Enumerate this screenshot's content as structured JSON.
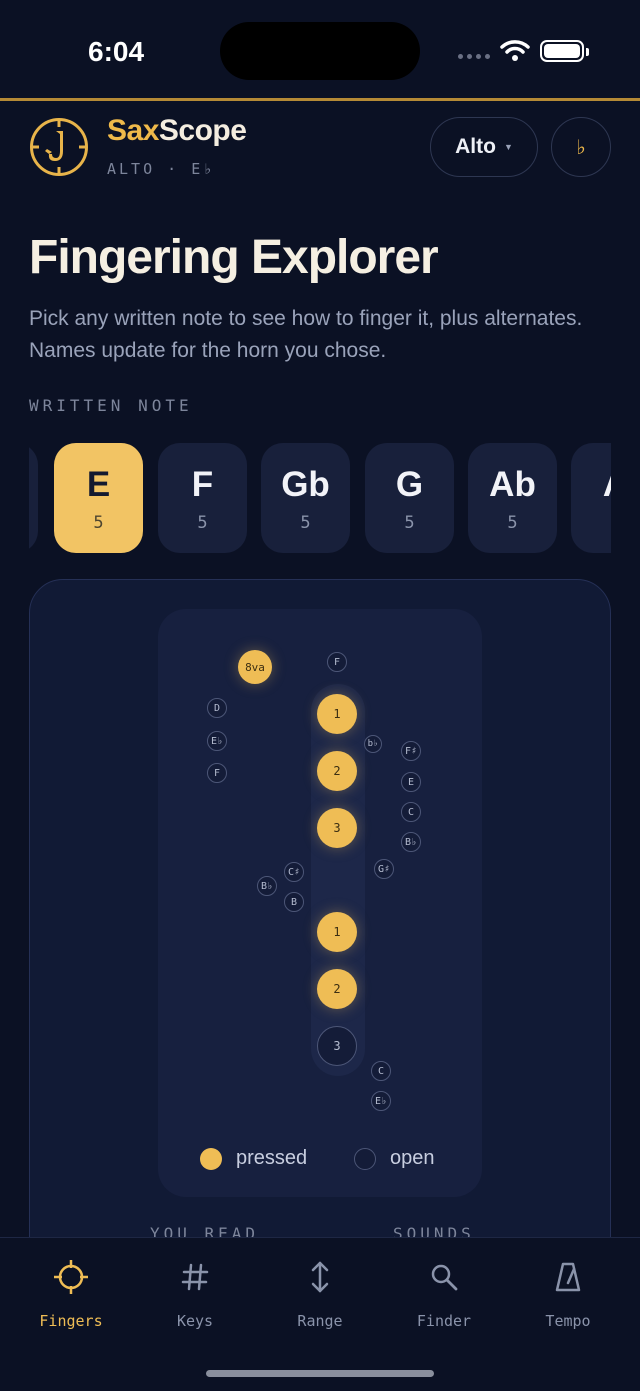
{
  "status": {
    "time": "6:04"
  },
  "header": {
    "brand_sax": "Sax",
    "brand_scope": "Scope",
    "subtitle": "ALTO · E♭",
    "horn_button": "Alto",
    "accidental_button": "♭"
  },
  "page": {
    "title": "Fingering Explorer",
    "description": "Pick any written note to see how to finger it, plus alternates. Names update for the horn you chose.",
    "section_label": "WRITTEN NOTE"
  },
  "notes": [
    {
      "name": "E",
      "octave": "5",
      "selected": true
    },
    {
      "name": "F",
      "octave": "5",
      "selected": false
    },
    {
      "name": "Gb",
      "octave": "5",
      "selected": false
    },
    {
      "name": "G",
      "octave": "5",
      "selected": false
    },
    {
      "name": "Ab",
      "octave": "5",
      "selected": false
    },
    {
      "name": "A",
      "octave": "",
      "selected": false
    }
  ],
  "diagram": {
    "octave_key": "8va",
    "keys": {
      "top_f": "F",
      "palm_d": "D",
      "palm_eb": "E♭",
      "palm_f": "F",
      "upper_1": "1",
      "upper_2": "2",
      "upper_3": "3",
      "bis": "b♭",
      "side_fs": "F♯",
      "side_e": "E",
      "side_c": "C",
      "side_bb": "B♭",
      "g_sharp": "G♯",
      "pinky_cs": "C♯",
      "pinky_bb": "B♭",
      "pinky_b": "B",
      "lower_1": "1",
      "lower_2": "2",
      "lower_3": "3",
      "low_c": "C",
      "low_eb": "E♭"
    },
    "legend_pressed": "pressed",
    "legend_open": "open"
  },
  "readout": {
    "you_read": "YOU READ",
    "sounds": "SOUNDS"
  },
  "tabs": [
    {
      "label": "Fingers",
      "icon": "crosshair-icon",
      "active": true
    },
    {
      "label": "Keys",
      "icon": "hash-icon",
      "active": false
    },
    {
      "label": "Range",
      "icon": "vertical-arrows-icon",
      "active": false
    },
    {
      "label": "Finder",
      "icon": "search-icon",
      "active": false
    },
    {
      "label": "Tempo",
      "icon": "metronome-icon",
      "active": false
    }
  ],
  "colors": {
    "accent": "#efbd55",
    "background": "#0b1124",
    "card": "#111a35"
  }
}
